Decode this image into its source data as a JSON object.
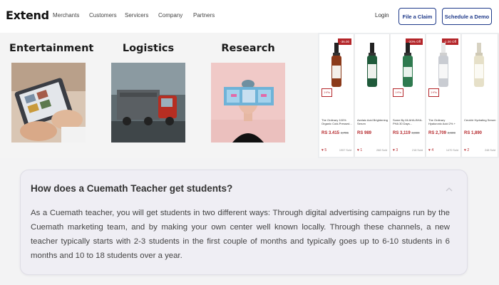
{
  "nav": {
    "logo": "Extend",
    "links": [
      "Merchants",
      "Customers",
      "Servicers",
      "Company",
      "Partners"
    ],
    "login": "Login",
    "file_claim": "File a Claim",
    "schedule_demo": "Schedule a Demo"
  },
  "categories": [
    {
      "title": "Entertainment",
      "image": "tablet-photo"
    },
    {
      "title": "Logistics",
      "image": "truck-photo"
    },
    {
      "title": "Research",
      "image": "vr-headset-photo"
    }
  ],
  "products": [
    {
      "badge": "-36.00",
      "tag": "1+Pa",
      "name": "The Ordinary 100% Organic Cold-Pressed...",
      "price": "RS 3.415",
      "old_price": "4,795",
      "heart": "♥ 5",
      "sold": "1957 Sold",
      "color": "#8b3a1a"
    },
    {
      "badge": "",
      "tag": "",
      "name": "Azelaic Acid Brightening Serum",
      "price": "RS 989",
      "old_price": "",
      "heart": "♥ 1",
      "sold": "268 Sold",
      "color": "#1f5a3a"
    },
    {
      "badge": "-20% Off",
      "tag": "1+Pa",
      "name": "Some By Mi AHA-BHA-PHA 30 Days...",
      "price": "RS 3,119",
      "old_price": "3,899",
      "heart": "♥ 3",
      "sold": "218 Sold",
      "color": "#2f7a4f"
    },
    {
      "badge": "-1.00 Off",
      "tag": "1+Pa",
      "name": "The Ordinary Hyaluronic Acid 2% + B5",
      "price": "RS 2,709",
      "old_price": "2,999",
      "heart": "♥ 4",
      "sold": "1470 Sold",
      "color": "#c9ccd2"
    },
    {
      "badge": "",
      "tag": "",
      "name": "CeraVe Hydrating Serum",
      "price": "RS 1,890",
      "old_price": "",
      "heart": "♥ 2",
      "sold": "248 Sold",
      "color": "#e6e0c8"
    }
  ],
  "faq": {
    "question": "How does a Cuemath Teacher get students?",
    "answer": "As a Cuemath teacher, you will get students in two different ways: Through digital advertising campaigns run by the Cuemath marketing team, and by making your own center well known locally. Through these channels, a new teacher typically starts with 2-3 students in the first couple of months and typically goes up to 6-10 students in 6 months and 10 to 18 students over a year."
  }
}
